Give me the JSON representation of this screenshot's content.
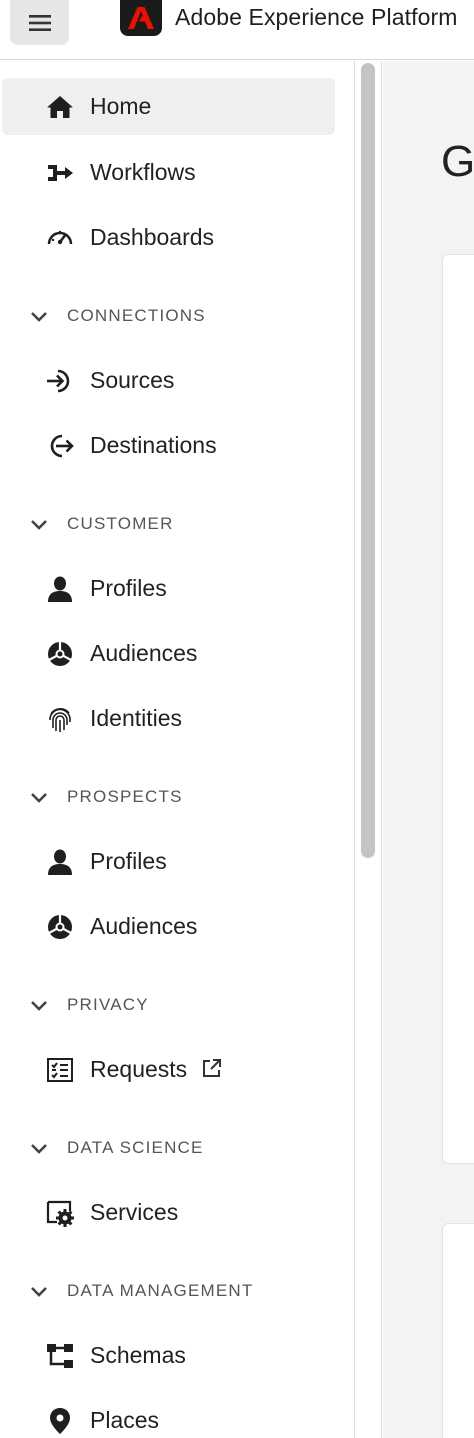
{
  "header": {
    "app_title": "Adobe Experience Platform",
    "menu_icon": "hamburger-icon",
    "logo_icon": "adobe-logo-icon"
  },
  "sidebar": {
    "items": [
      {
        "label": "Home",
        "icon": "home-icon",
        "active": true
      },
      {
        "label": "Workflows",
        "icon": "workflow-icon"
      },
      {
        "label": "Dashboards",
        "icon": "gauge-icon"
      }
    ],
    "sections": [
      {
        "title": "CONNECTIONS",
        "items": [
          {
            "label": "Sources",
            "icon": "sign-in-icon"
          },
          {
            "label": "Destinations",
            "icon": "sign-out-icon"
          }
        ]
      },
      {
        "title": "CUSTOMER",
        "items": [
          {
            "label": "Profiles",
            "icon": "user-icon"
          },
          {
            "label": "Audiences",
            "icon": "audience-icon"
          },
          {
            "label": "Identities",
            "icon": "fingerprint-icon"
          }
        ]
      },
      {
        "title": "PROSPECTS",
        "items": [
          {
            "label": "Profiles",
            "icon": "user-icon"
          },
          {
            "label": "Audiences",
            "icon": "audience-icon"
          }
        ]
      },
      {
        "title": "PRIVACY",
        "items": [
          {
            "label": "Requests",
            "icon": "checklist-icon",
            "external_icon": "external-link-icon"
          }
        ]
      },
      {
        "title": "DATA SCIENCE",
        "items": [
          {
            "label": "Services",
            "icon": "service-gear-icon"
          }
        ]
      },
      {
        "title": "DATA MANAGEMENT",
        "items": [
          {
            "label": "Schemas",
            "icon": "schema-icon"
          },
          {
            "label": "Places",
            "icon": "location-pin-icon"
          }
        ]
      }
    ]
  },
  "main": {
    "heading": "G"
  },
  "colors": {
    "active_bg": "#efefef",
    "section_text": "#555555",
    "logo_bg": "#1a1a1a",
    "logo_mark": "#eb1000",
    "main_bg": "#f3f3f3"
  }
}
